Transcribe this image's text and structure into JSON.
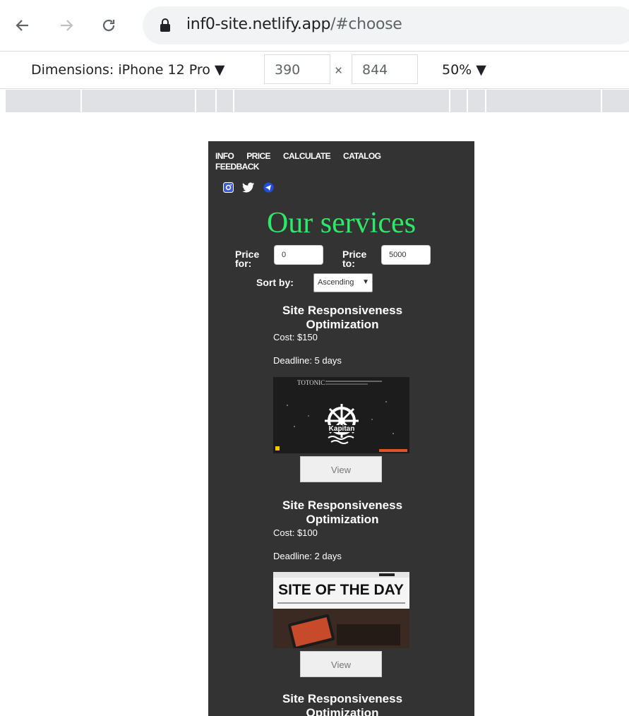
{
  "browser": {
    "url_host": "inf0-site.netlify.app",
    "url_path": "/#choose"
  },
  "devtools": {
    "dimensions_label": "Dimensions: iPhone 12 Pro ▼",
    "width_value": "390",
    "times_sign": "×",
    "height_value": "844",
    "zoom_label": "50% ▼"
  },
  "site": {
    "nav": [
      "INFO",
      "PRICE",
      "CALCULATE",
      "CATALOG",
      "FEEDBACK"
    ],
    "socials": [
      "instagram-icon",
      "twitter-icon",
      "telegram-icon"
    ],
    "heading": "Our services",
    "filter": {
      "price_for_label": "Price for:",
      "price_for_value": "0",
      "price_to_label": "Price to:",
      "price_to_value": "5000",
      "sort_label": "Sort by:",
      "sort_value": "Ascending"
    },
    "cards": [
      {
        "title": "Site Responsiveness Optimization",
        "cost": "Cost: $150",
        "deadline": "Deadline: 5 days",
        "image_caption": "Kapitan",
        "button": "View"
      },
      {
        "title": "Site Responsiveness Optimization",
        "cost": "Cost: $100",
        "deadline": "Deadline: 2 days",
        "image_caption": "SITE OF THE DAY",
        "button": "View"
      },
      {
        "title": "Site Responsiveness Optimization"
      }
    ]
  },
  "colors": {
    "page_bg": "#333333",
    "heading": "#2ee86a",
    "ruler": "#dfe1e5"
  }
}
